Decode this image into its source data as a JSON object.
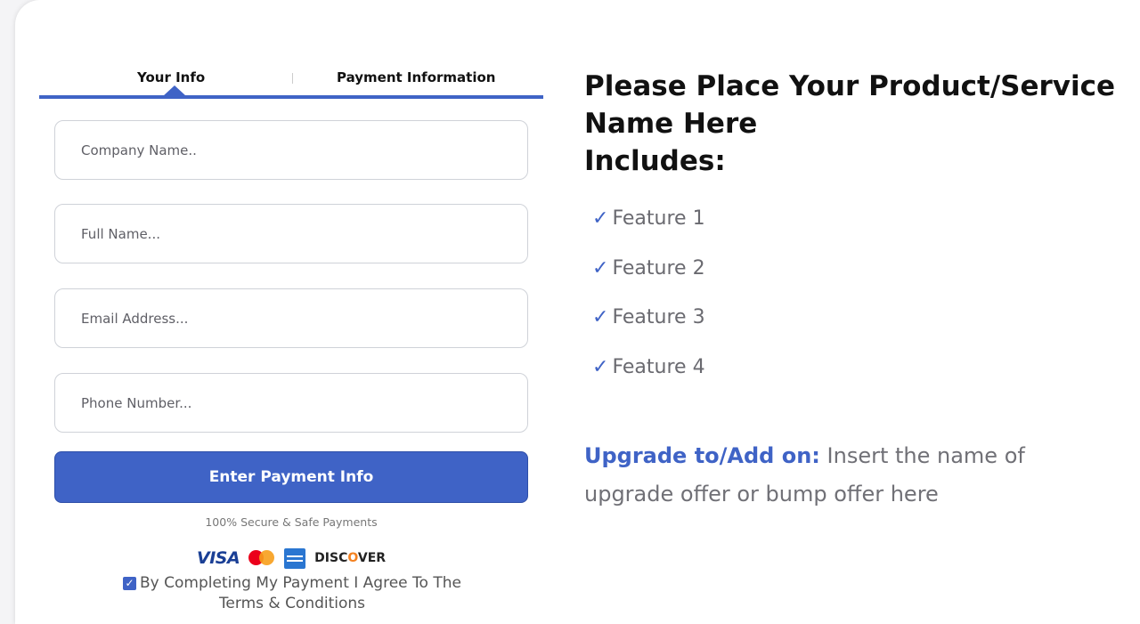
{
  "tabs": {
    "your_info": "Your Info",
    "payment": "Payment Information"
  },
  "form": {
    "company_placeholder": "Company Name..",
    "fullname_placeholder": "Full Name...",
    "email_placeholder": "Email Address...",
    "phone_placeholder": "Phone Number...",
    "submit_label": "Enter Payment Info",
    "secure_text": "100% Secure & Safe Payments",
    "terms_text": "By Completing My Payment I Agree To The Terms & Conditions",
    "terms_checked": true
  },
  "card_logos": {
    "visa": "VISA",
    "discover_pre": "DISC",
    "discover_o": "O",
    "discover_post": "VER"
  },
  "product": {
    "title": "Please Place Your Product/Service Name Here",
    "includes": "Includes:",
    "check_glyph": "✓",
    "features": [
      "Feature 1",
      "Feature 2",
      "Feature 3",
      "Feature 4"
    ]
  },
  "upgrade": {
    "lead": "Upgrade to/Add on:",
    "text": "Insert the name of upgrade offer or bump offer here"
  },
  "colors": {
    "accent": "#3f63c6",
    "text_dark": "#111111",
    "text_muted": "#6a6a70"
  },
  "icons": [
    "check-icon",
    "checkbox-icon",
    "visa-logo-icon",
    "mastercard-logo-icon",
    "amex-logo-icon",
    "discover-logo-icon"
  ]
}
